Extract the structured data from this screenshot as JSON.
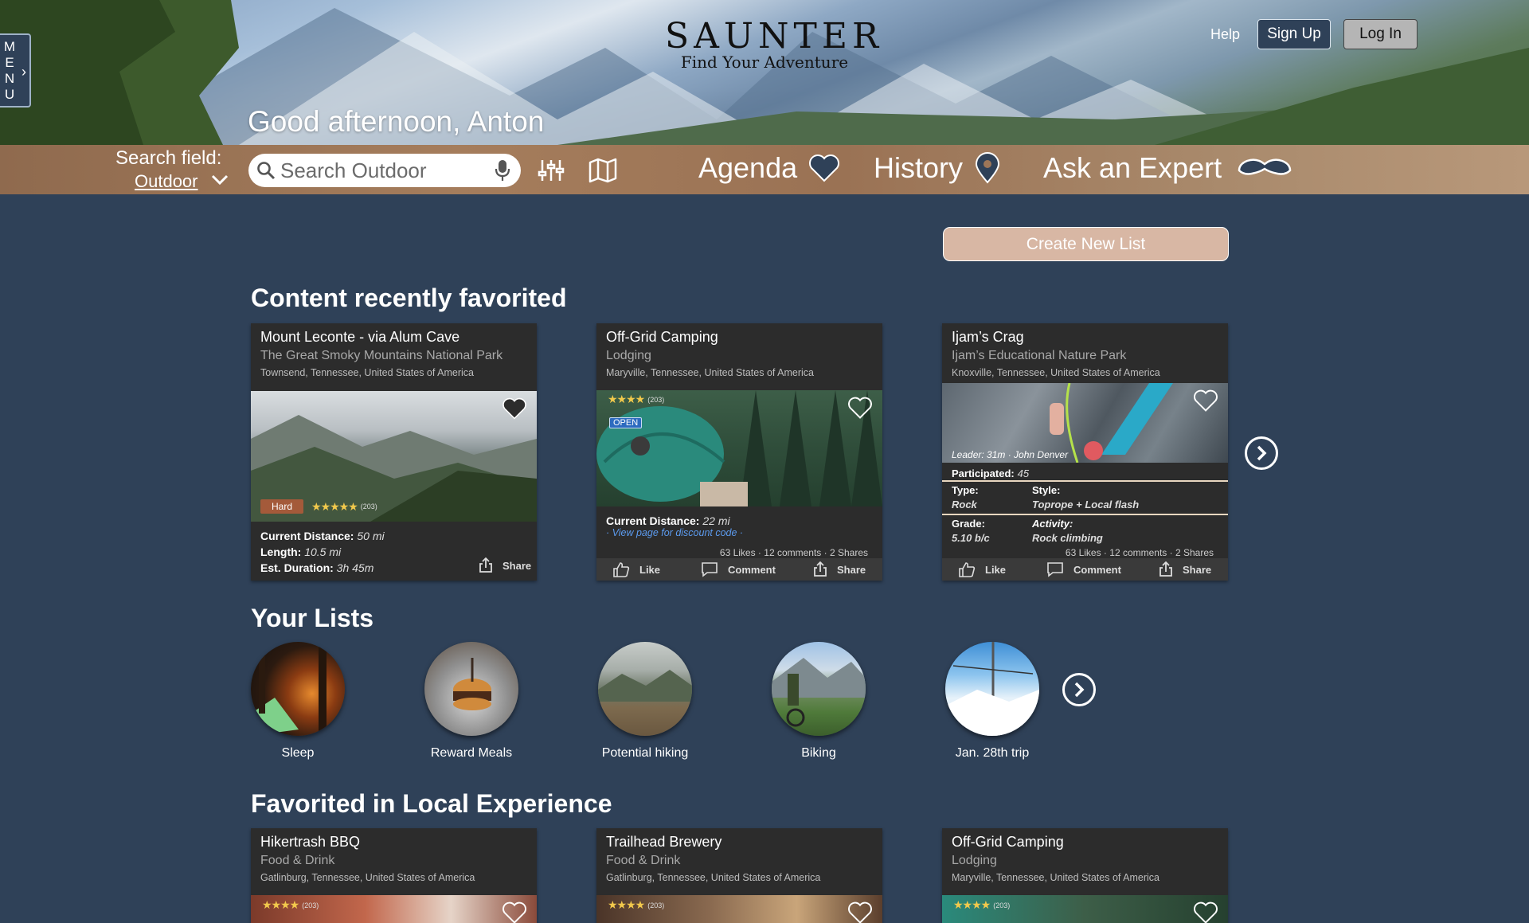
{
  "header": {
    "menu_letters": [
      "M",
      "E",
      "N",
      "U"
    ],
    "logo_word": "SAUNTER",
    "logo_tagline": "Find Your Adventure",
    "help": "Help",
    "sign_up": "Sign Up",
    "log_in": "Log In",
    "greeting": "Good afternoon, Anton"
  },
  "search": {
    "field_label": "Search field:",
    "field_value": "Outdoor",
    "placeholder": "Search Outdoor"
  },
  "nav": {
    "agenda": "Agenda",
    "history": "History",
    "ask_expert": "Ask an Expert"
  },
  "create_list": "Create New List",
  "recent": {
    "title": "Content recently favorited",
    "cards": [
      {
        "title": "Mount Leconte - via Alum Cave",
        "subtitle": "The Great Smoky Mountains National Park",
        "location": "Townsend, Tennessee, United States of America",
        "difficulty": "Hard",
        "stars": "★★★★★",
        "rating_count": "(203)",
        "distance_label": "Current Distance:",
        "distance": "50 mi",
        "length_label": "Length:",
        "length": "10.5 mi",
        "duration_label": "Est. Duration:",
        "duration": "3h 45m",
        "share": "Share"
      },
      {
        "title": "Off-Grid Camping",
        "subtitle": "Lodging",
        "location": "Maryville, Tennessee, United States of America",
        "stars": "★★★★",
        "rating_count": "(203)",
        "open": "OPEN",
        "distance_label": "Current Distance:",
        "distance": "22 mi",
        "discount": "· View page for discount code ·",
        "stats": "63 Likes · 12 comments · 2 Shares",
        "like": "Like",
        "comment": "Comment",
        "share": "Share"
      },
      {
        "title": "Ijam’s Crag",
        "subtitle": "Ijam’s Educational Nature Park",
        "location": "Knoxville, Tennessee, United States of America",
        "leader": "Leader: 31m · John Denver",
        "participated_label": "Participated:",
        "participated": "45",
        "type_label": "Type:",
        "type": "Rock",
        "style_label": "Style:",
        "style": "Toprope + Local flash",
        "grade_label": "Grade:",
        "grade": "5.10 b/c",
        "activity_label": "Activity:",
        "activity": "Rock climbing",
        "stats": "63 Likes · 12 comments · 2 Shares",
        "like": "Like",
        "comment": "Comment",
        "share": "Share"
      }
    ]
  },
  "lists": {
    "title": "Your Lists",
    "items": [
      {
        "label": "Sleep"
      },
      {
        "label": "Reward Meals"
      },
      {
        "label": "Potential hiking"
      },
      {
        "label": "Biking"
      },
      {
        "label": "Jan. 28th trip"
      }
    ]
  },
  "local": {
    "title": "Favorited in Local Experience",
    "cards": [
      {
        "title": "Hikertrash BBQ",
        "subtitle": "Food & Drink",
        "location": "Gatlinburg, Tennessee, United States of America",
        "stars": "★★★★",
        "rating_count": "(203)"
      },
      {
        "title": "Trailhead Brewery",
        "subtitle": "Food & Drink",
        "location": "Gatlinburg, Tennessee, United States of America",
        "stars": "★★★★",
        "rating_count": "(203)"
      },
      {
        "title": "Off-Grid Camping",
        "subtitle": "Lodging",
        "location": "Maryville, Tennessee, United States of America",
        "stars": "★★★★",
        "rating_count": "(203)"
      }
    ]
  }
}
